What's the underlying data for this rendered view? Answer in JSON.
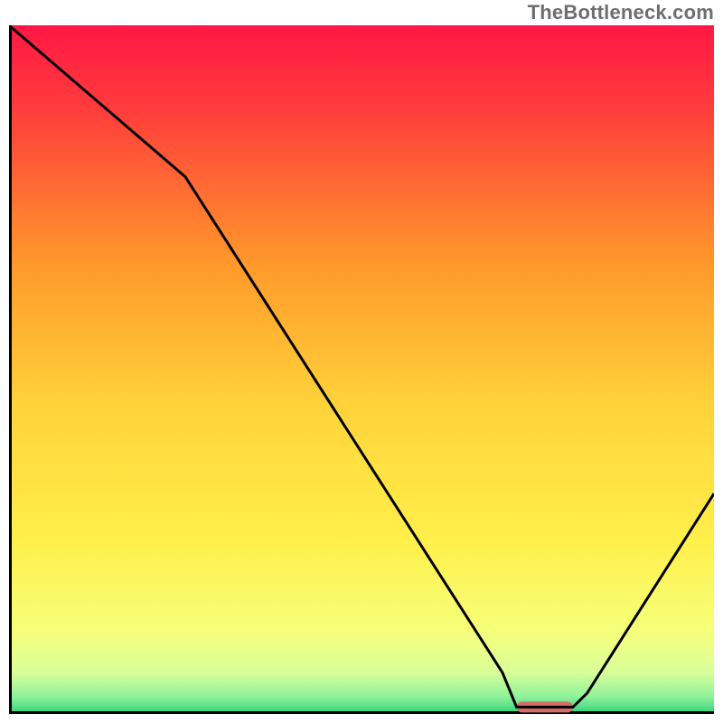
{
  "watermark": "TheBottleneck.com",
  "chart_data": {
    "type": "line",
    "title": "",
    "xlabel": "",
    "ylabel": "",
    "xlim": [
      0,
      100
    ],
    "ylim": [
      0,
      100
    ],
    "grid": false,
    "legend": false,
    "series": [
      {
        "name": "curve",
        "x": [
          0,
          25,
          70,
          72,
          80,
          82,
          100
        ],
        "values": [
          100,
          78,
          6,
          1,
          1,
          3,
          32
        ]
      }
    ],
    "minimum_marker": {
      "x_start": 72,
      "x_end": 80,
      "y": 1,
      "color": "#d86a6a"
    },
    "background_gradient": {
      "stops": [
        {
          "pos": 0.0,
          "color": "#ff1744"
        },
        {
          "pos": 0.12,
          "color": "#ff3c3c"
        },
        {
          "pos": 0.35,
          "color": "#ff9a2a"
        },
        {
          "pos": 0.55,
          "color": "#ffd23a"
        },
        {
          "pos": 0.75,
          "color": "#fff04a"
        },
        {
          "pos": 0.88,
          "color": "#f6ff7a"
        },
        {
          "pos": 0.94,
          "color": "#d8ff9a"
        },
        {
          "pos": 0.975,
          "color": "#8ff29a"
        },
        {
          "pos": 1.0,
          "color": "#2fd27a"
        }
      ]
    },
    "axis_color": "#000000",
    "line_color": "#000000"
  }
}
